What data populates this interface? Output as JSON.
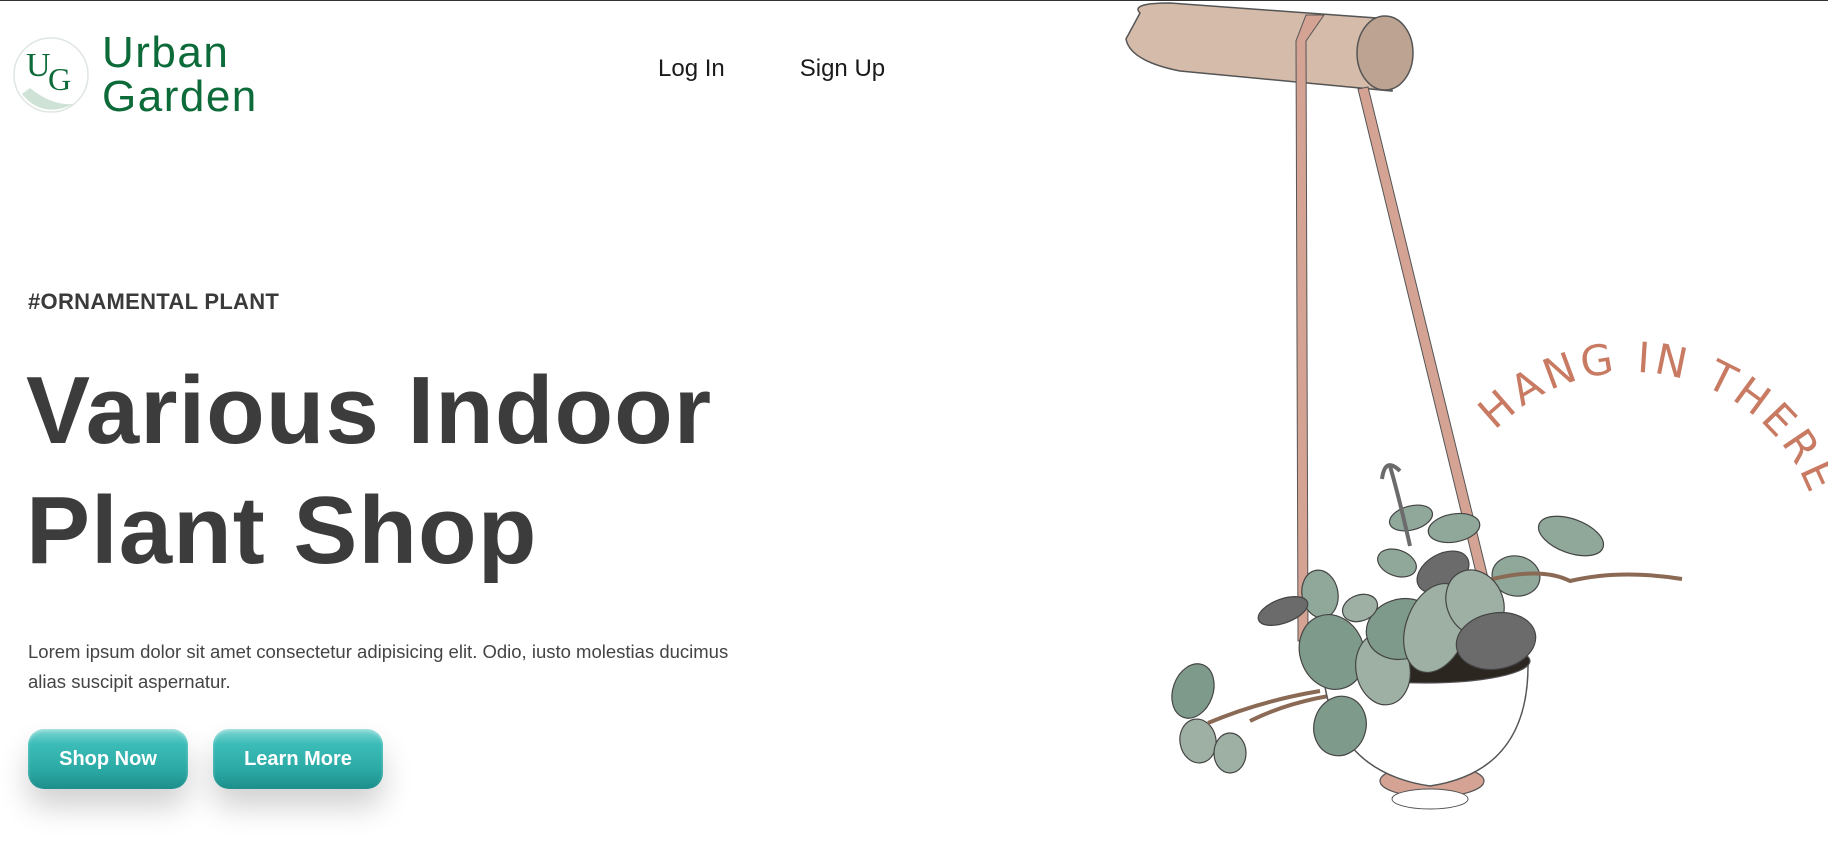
{
  "brand": {
    "line1": "Urban",
    "line2": "Garden",
    "monogram_u": "U",
    "monogram_g": "G"
  },
  "nav": {
    "login": "Log In",
    "signup": "Sign Up"
  },
  "hero": {
    "tag": "#ORNAMENTAL PLANT",
    "title_line1": "Various Indoor",
    "title_line2": "Plant Shop",
    "description": "Lorem ipsum dolor sit amet consectetur adipisicing elit. Odio, iusto molestias ducimus alias suscipit aspernatur.",
    "shop_button": "Shop Now",
    "learn_button": "Learn More"
  },
  "illustration": {
    "arc_text": "HANG IN THERE"
  },
  "colors": {
    "brand_green": "#0d6b3a",
    "button_teal": "#2aa8a4",
    "heading_gray": "#3c3c3c",
    "arc_text": "#c97a62",
    "rope": "#d4a394",
    "leaf": "#8fa89a"
  },
  "icons": [
    "logo-mark",
    "hanging-plant-illustration"
  ]
}
